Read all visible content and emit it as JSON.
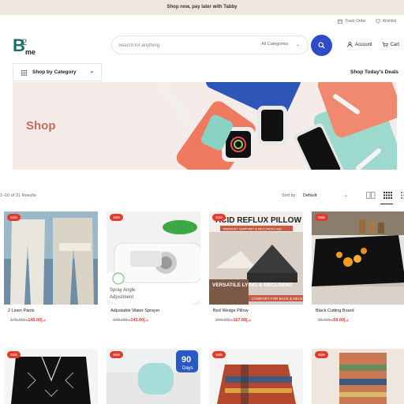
{
  "promo": {
    "text": "Shop now, pay later with Tabby"
  },
  "toplinks": {
    "track_order": "Track Order",
    "wishlist": "Wishlist"
  },
  "logo": {
    "text": "B2me"
  },
  "search": {
    "placeholder": "Search for anything",
    "category": "All Categories"
  },
  "header": {
    "account": "Account",
    "cart": "Cart"
  },
  "nav": {
    "shop_by_category": "Shop by Category",
    "deals": "Shop Today's Deals"
  },
  "banner": {
    "title": "Shop"
  },
  "listing": {
    "results": "1–16 of 31 Results",
    "sort_label": "Sort by:",
    "sort_value": "Default"
  },
  "products": [
    {
      "badge": "Sale",
      "title": "2 Linen Pants",
      "price": "145.00",
      "old_price": "175.00"
    },
    {
      "badge": "Sale",
      "title": "Adjustable Water Sprayer",
      "price": "143.00",
      "old_price": "199.00",
      "img_text_1": "Spray Angle",
      "img_text_2": "Adjustment"
    },
    {
      "badge": "Sale",
      "title": "Bed Wedge Pillow",
      "price": "167.00",
      "old_price": "200.00",
      "img_text_1": "ACID REFLUX PILLOW",
      "img_text_2": "BEDREST SUPPORT & RECOVERY AID",
      "img_text_3": "VERSATILE LYING & RECLINING",
      "img_text_4": "COMFORT FOR BACK & NECK"
    },
    {
      "badge": "Sale",
      "title": "Black Cutting Board",
      "price": "59.00",
      "old_price": "65.00"
    }
  ],
  "products_row2": [
    {
      "badge": "Sale"
    },
    {
      "badge": "Sale",
      "img_text_1": "90",
      "img_text_2": "Days"
    },
    {
      "badge": "Sale"
    },
    {
      "badge": "Sale"
    }
  ],
  "currency_symbol": "د.إ",
  "colors": {
    "accent": "#2f4bc8",
    "sale": "#e03b2e",
    "banner_bg": "#f5ecea",
    "promo_bg": "#efe7de"
  }
}
